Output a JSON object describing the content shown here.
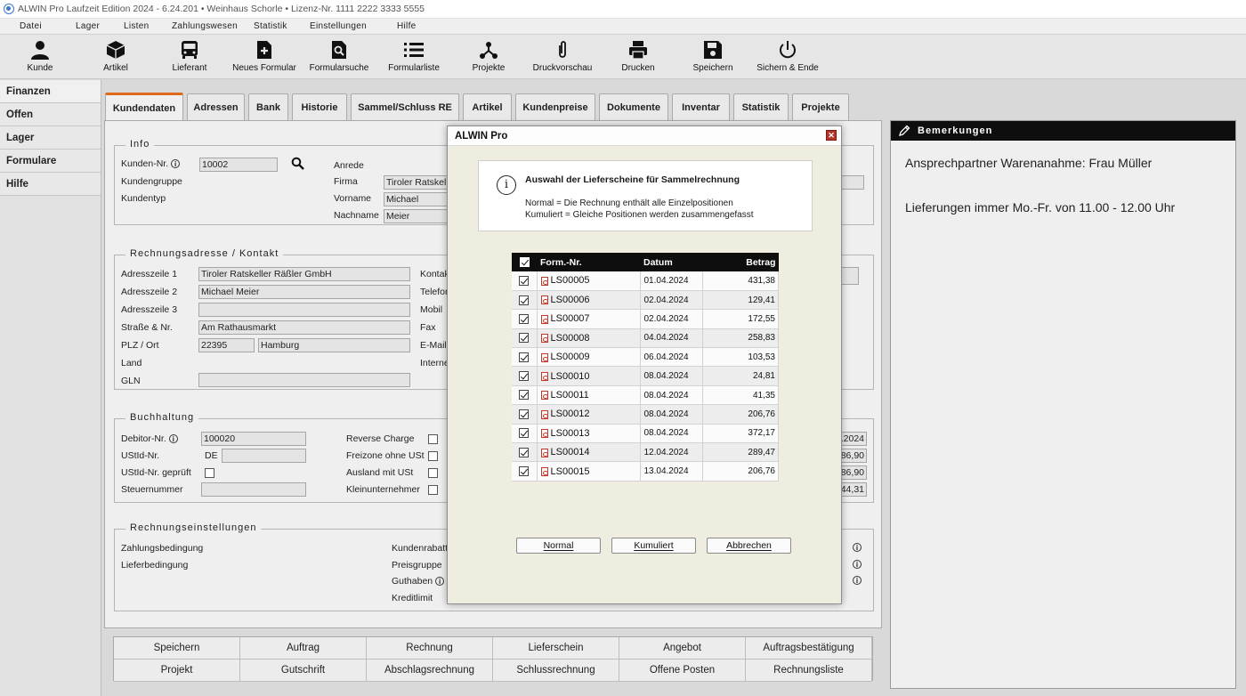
{
  "window": {
    "title": "ALWIN Pro Laufzeit Edition 2024 - 6.24.201 • Weinhaus Schorle • Lizenz-Nr. 1111 2222 3333 5555"
  },
  "menu": [
    "Datei",
    "Lager",
    "Listen",
    "Zahlungswesen",
    "Statistik",
    "Einstellungen",
    "Hilfe"
  ],
  "toolbar": {
    "kunde": "Kunde",
    "artikel": "Artikel",
    "lieferant": "Lieferant",
    "neues_formular": "Neues Formular",
    "formularsuche": "Formularsuche",
    "formularliste": "Formularliste",
    "projekte": "Projekte",
    "druckvorschau": "Druckvorschau",
    "drucken": "Drucken",
    "speichern": "Speichern",
    "sichern_ende": "Sichern & Ende"
  },
  "sidebar": [
    "Finanzen",
    "Offen",
    "Lager",
    "Formulare",
    "Hilfe"
  ],
  "tabs": [
    "Kundendaten",
    "Adressen",
    "Bank",
    "Historie",
    "Sammel/Schluss RE",
    "Artikel",
    "Kundenpreise",
    "Dokumente",
    "Inventar",
    "Statistik",
    "Projekte"
  ],
  "info": {
    "legend": "Info",
    "kunden_nr_label": "Kunden-Nr.",
    "kunden_nr": "10002",
    "kundengruppe_label": "Kundengruppe",
    "kundentyp_label": "Kundentyp",
    "anrede_label": "Anrede",
    "firma_label": "Firma",
    "firma": "Tiroler Ratskeller",
    "vorname_label": "Vorname",
    "vorname": "Michael",
    "nachname_label": "Nachname",
    "nachname": "Meier"
  },
  "rechnung": {
    "legend": "Rechnungsadresse / Kontakt",
    "adr1_label": "Adresszeile 1",
    "adr1": "Tiroler Ratskeller Räßler GmbH",
    "adr2_label": "Adresszeile 2",
    "adr2": "Michael Meier",
    "adr3_label": "Adresszeile 3",
    "strasse_label": "Straße & Nr.",
    "strasse": "Am Rathausmarkt",
    "plz_label": "PLZ / Ort",
    "plz": "22395",
    "ort": "Hamburg",
    "land_label": "Land",
    "gln_label": "GLN",
    "kontakt_label": "Kontakt",
    "telefon_label": "Telefon",
    "mobil_label": "Mobil",
    "fax_label": "Fax",
    "email_label": "E-Mail",
    "internet_label": "Internet"
  },
  "buchhaltung": {
    "legend": "Buchhaltung",
    "debitor_label": "Debitor-Nr.",
    "debitor": "100020",
    "ustid_label": "UStId-Nr.",
    "ustid_prefix": "DE",
    "ustid_geprueft_label": "UStId-Nr. geprüft",
    "steuernummer_label": "Steuernummer",
    "reverse_label": "Reverse Charge",
    "freizone_label": "Freizone ohne USt",
    "ausland_label": "Ausland mit USt",
    "klein_label": "Kleinunternehmer",
    "right_values": [
      ".2024",
      "86,90",
      "86,90",
      "44,31"
    ]
  },
  "einstellungen": {
    "legend": "Rechnungseinstellungen",
    "zahlung_label": "Zahlungsbedingung",
    "liefer_label": "Lieferbedingung",
    "rabatt_label": "Kundenrabatt",
    "preisgruppe_label": "Preisgruppe",
    "guthaben_label": "Guthaben",
    "kreditlimit_label": "Kreditlimit"
  },
  "bottom_buttons": [
    "Speichern",
    "Auftrag",
    "Rechnung",
    "Lieferschein",
    "Angebot",
    "Auftragsbestätigung",
    "Projekt",
    "Gutschrift",
    "Abschlagsrechnung",
    "Schlussrechnung",
    "Offene Posten",
    "Rechnungsliste"
  ],
  "remarks": {
    "title": "Bemerkungen",
    "lines": [
      "Ansprechpartner Warenanahme: Frau Müller",
      "Lieferungen immer Mo.-Fr. von 11.00 - 12.00 Uhr"
    ]
  },
  "dialog": {
    "title": "ALWIN Pro",
    "info_title": "Auswahl der Lieferscheine für Sammelrechnung",
    "info_line1": "Normal = Die Rechnung enthält alle Einzelpositionen",
    "info_line2": "Kumuliert = Gleiche Positionen werden zusammengefasst",
    "columns": {
      "form_nr": "Form.-Nr.",
      "datum": "Datum",
      "betrag": "Betrag"
    },
    "rows": [
      {
        "nr": "LS00005",
        "datum": "01.04.2024",
        "betrag": "431,38"
      },
      {
        "nr": "LS00006",
        "datum": "02.04.2024",
        "betrag": "129,41"
      },
      {
        "nr": "LS00007",
        "datum": "02.04.2024",
        "betrag": "172,55"
      },
      {
        "nr": "LS00008",
        "datum": "04.04.2024",
        "betrag": "258,83"
      },
      {
        "nr": "LS00009",
        "datum": "06.04.2024",
        "betrag": "103,53"
      },
      {
        "nr": "LS00010",
        "datum": "08.04.2024",
        "betrag": "24,81"
      },
      {
        "nr": "LS00011",
        "datum": "08.04.2024",
        "betrag": "41,35"
      },
      {
        "nr": "LS00012",
        "datum": "08.04.2024",
        "betrag": "206,76"
      },
      {
        "nr": "LS00013",
        "datum": "08.04.2024",
        "betrag": "372,17"
      },
      {
        "nr": "LS00014",
        "datum": "12.04.2024",
        "betrag": "289,47"
      },
      {
        "nr": "LS00015",
        "datum": "13.04.2024",
        "betrag": "206,76"
      }
    ],
    "btn_normal": "Normal",
    "btn_kumuliert": "Kumuliert",
    "btn_abbrechen": "Abbrechen"
  }
}
